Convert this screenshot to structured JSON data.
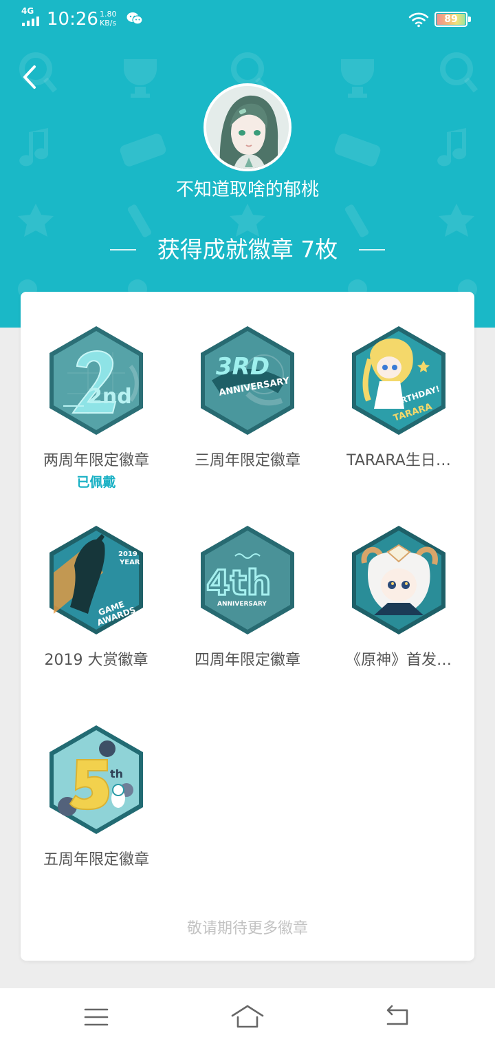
{
  "status_bar": {
    "network": "4G",
    "time": "10:26",
    "speed_value": "1.80",
    "speed_unit": "KB/s",
    "battery_level": "89",
    "icons": [
      "signal-icon",
      "wechat-icon",
      "wifi-icon",
      "battery-icon"
    ]
  },
  "header": {
    "username": "不知道取啥的郁桃",
    "badge_count_text": "获得成就徽章 7枚",
    "background_color": "#1ab8c7",
    "back_icon": "chevron-left-icon"
  },
  "badges": [
    {
      "name": "两周年限定徽章",
      "status": "已佩戴",
      "art_text": "2nd",
      "theme": "#44969c"
    },
    {
      "name": "三周年限定徽章",
      "status": "",
      "art_text": "3RD ANNIVERSARY",
      "theme": "#3a8d95"
    },
    {
      "name": "TARARA生日…",
      "status": "",
      "art_text": "HAPPY BIRTHDAY! TARARA",
      "theme": "#2a9aa6"
    },
    {
      "name": "2019 大赏徽章",
      "status": "",
      "art_text": "2019 YEAR GAME AWARDS",
      "theme": "#2b8ea0"
    },
    {
      "name": "四周年限定徽章",
      "status": "",
      "art_text": "4th ANNIVERSARY",
      "theme": "#3c8d94"
    },
    {
      "name": "《原神》首发…",
      "status": "",
      "art_text": "",
      "theme": "#2d8f9a"
    },
    {
      "name": "五周年限定徽章",
      "status": "",
      "art_text": "5th",
      "theme": "#2f97a3"
    }
  ],
  "more_hint": "敬请期待更多徽章",
  "navbar": {
    "icons": [
      "menu-icon",
      "home-icon",
      "back-icon"
    ]
  }
}
